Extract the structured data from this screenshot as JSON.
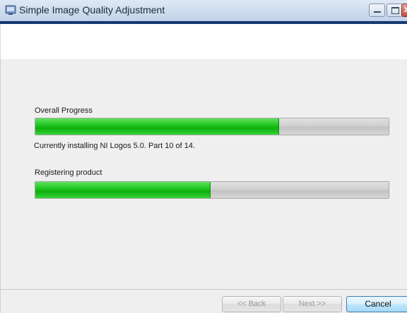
{
  "window": {
    "title": "Simple Image Quality Adjustment",
    "icon": "installer-icon"
  },
  "titlebar_buttons": {
    "minimize_icon": "minimize-icon",
    "maximize_icon": "maximize-icon",
    "close_icon": "close-icon",
    "close_glyph": "✕"
  },
  "progress": {
    "overall_label": "Overall Progress",
    "overall_fraction": 0.69,
    "status_text": "Currently installing NI Logos 5.0.  Part 10 of 14.",
    "sub_label": "Registering product",
    "sub_fraction": 0.495
  },
  "buttons": {
    "back": "<< Back",
    "next": "Next >>",
    "cancel": "Cancel"
  },
  "colors": {
    "accent_strip": "#15386f",
    "progress_green": "#22c722"
  }
}
